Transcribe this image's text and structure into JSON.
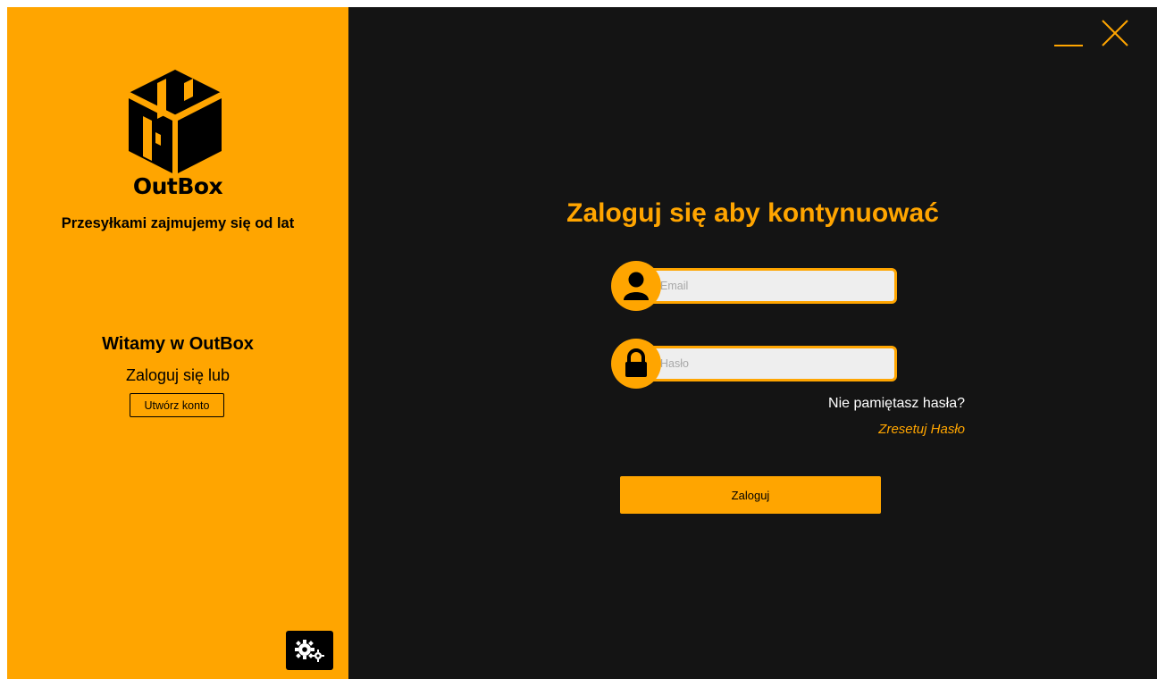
{
  "sidebar": {
    "brand": "OutBox",
    "tagline": "Przesyłkami zajmujemy się od lat",
    "welcome_title": "Witamy w OutBox",
    "welcome_subtitle": "Zaloguj się lub",
    "create_account_label": "Utwórz konto",
    "settings_icon": "gears-icon"
  },
  "window_controls": {
    "minimize_icon": "minimize-icon",
    "close_icon": "close-icon"
  },
  "login": {
    "heading": "Zaloguj się aby kontynuować",
    "email": {
      "value": "",
      "placeholder": "Email",
      "icon": "user-icon"
    },
    "password": {
      "value": "",
      "placeholder": "Hasło",
      "icon": "lock-icon"
    },
    "forgot_text": "Nie pamiętasz hasła?",
    "reset_link": "Zresetuj Hasło",
    "submit_label": "Zaloguj"
  },
  "colors": {
    "accent": "#FFA500",
    "background": "#141414",
    "field": "#EEEEEE",
    "text_light": "#FFFFFF",
    "text_dark": "#000000"
  }
}
